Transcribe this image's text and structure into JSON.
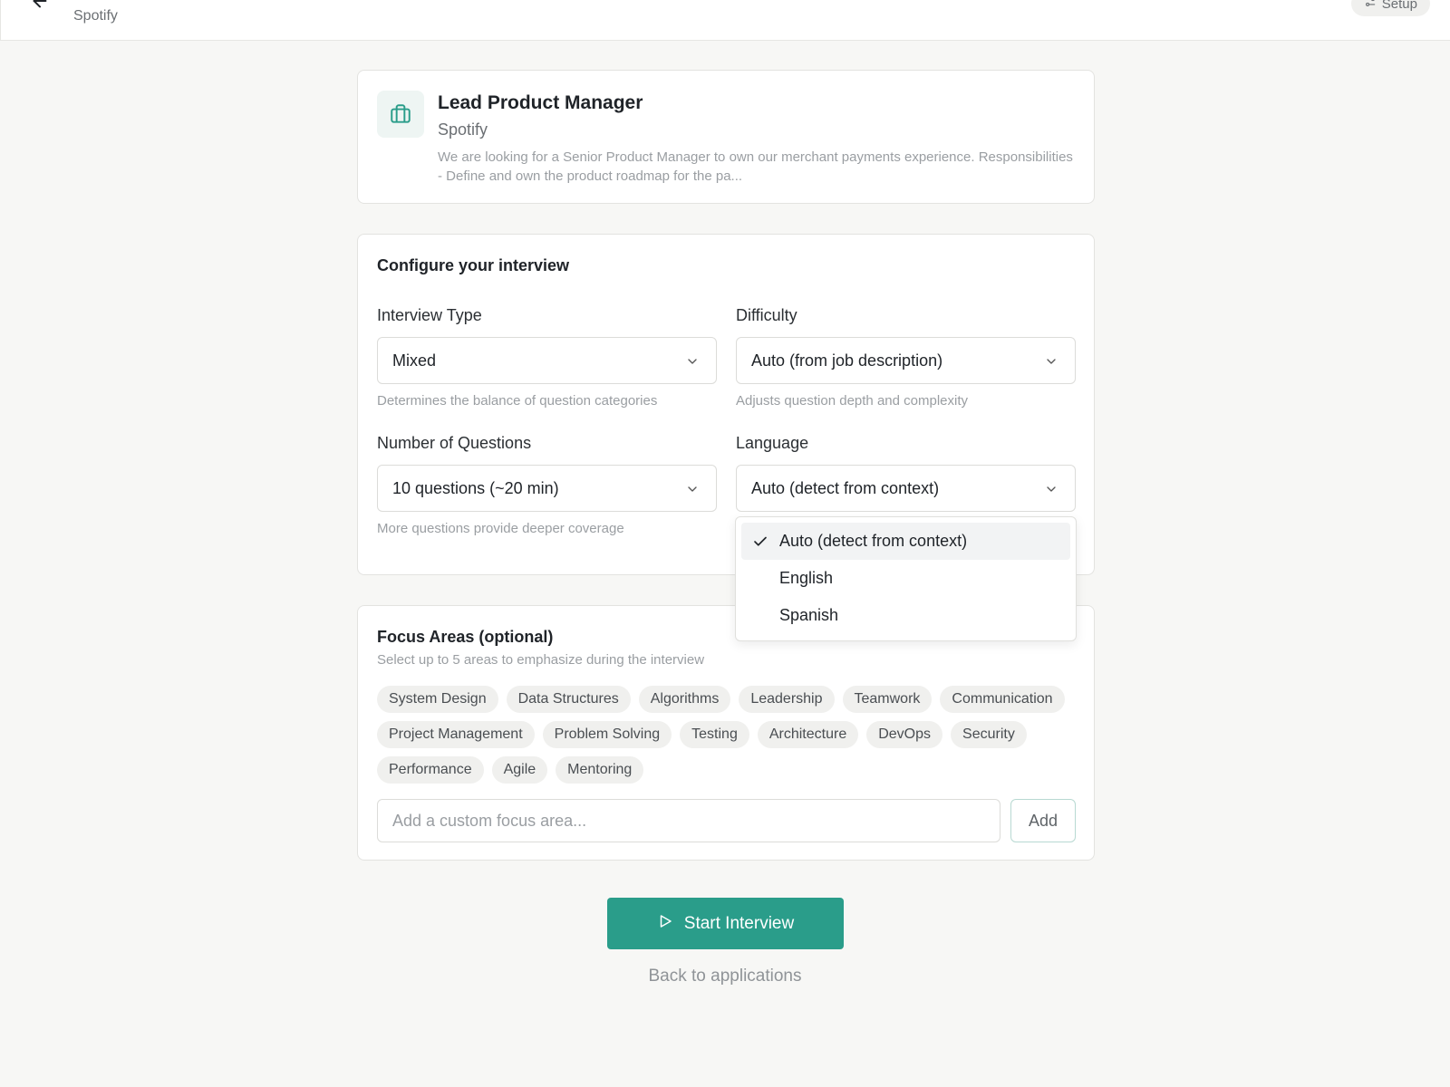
{
  "topbar": {
    "subtitle": "Spotify",
    "setup_label": "Setup"
  },
  "job": {
    "title": "Lead Product Manager",
    "company": "Spotify",
    "description": "We are looking for a Senior Product Manager to own our merchant payments experience. Responsibilities - Define and own the product roadmap for the pa..."
  },
  "config": {
    "title": "Configure your interview",
    "interview_type": {
      "label": "Interview Type",
      "value": "Mixed",
      "hint": "Determines the balance of question categories"
    },
    "difficulty": {
      "label": "Difficulty",
      "value": "Auto (from job description)",
      "hint": "Adjusts question depth and complexity"
    },
    "num_questions": {
      "label": "Number of Questions",
      "value": "10 questions (~20 min)",
      "hint": "More questions provide deeper coverage"
    },
    "language": {
      "label": "Language",
      "value": "Auto (detect from context)",
      "options": [
        "Auto (detect from context)",
        "English",
        "Spanish"
      ],
      "selected_index": 0
    }
  },
  "focus": {
    "title": "Focus Areas (optional)",
    "subtitle": "Select up to 5 areas to emphasize during the interview",
    "chips": [
      "System Design",
      "Data Structures",
      "Algorithms",
      "Leadership",
      "Teamwork",
      "Communication",
      "Project Management",
      "Problem Solving",
      "Testing",
      "Architecture",
      "DevOps",
      "Security",
      "Performance",
      "Agile",
      "Mentoring"
    ],
    "custom_placeholder": "Add a custom focus area...",
    "add_label": "Add"
  },
  "actions": {
    "start_label": "Start Interview",
    "back_label": "Back to applications"
  },
  "colors": {
    "accent": "#2a9d8a",
    "background": "#f7f7f5"
  }
}
